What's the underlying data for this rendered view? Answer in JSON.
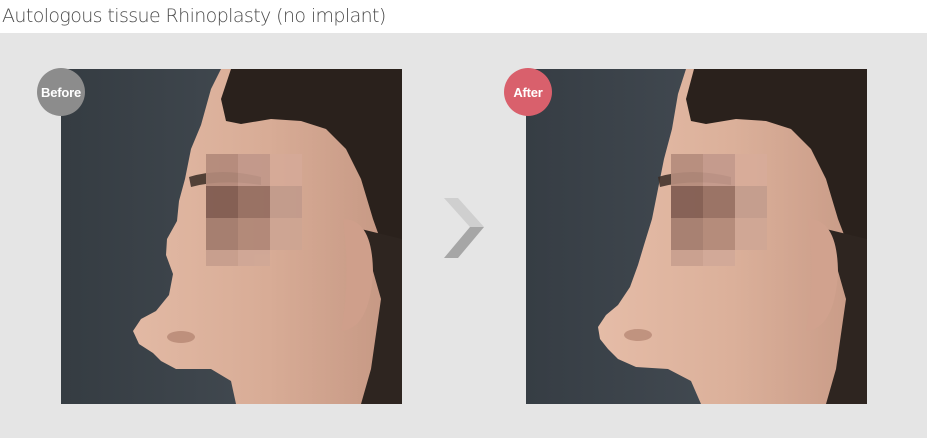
{
  "title": "Autologous tissue Rhinoplasty (no implant)",
  "badges": {
    "before": "Before",
    "after": "After"
  },
  "colors": {
    "before_badge": "#8c8c8c",
    "after_badge": "#d9606c",
    "panel_background": "#e5e5e5",
    "photo_background": "#3c4349",
    "arrow": "#a6a6a6"
  },
  "icons": {
    "transition_arrow": "chevron-right-icon"
  }
}
